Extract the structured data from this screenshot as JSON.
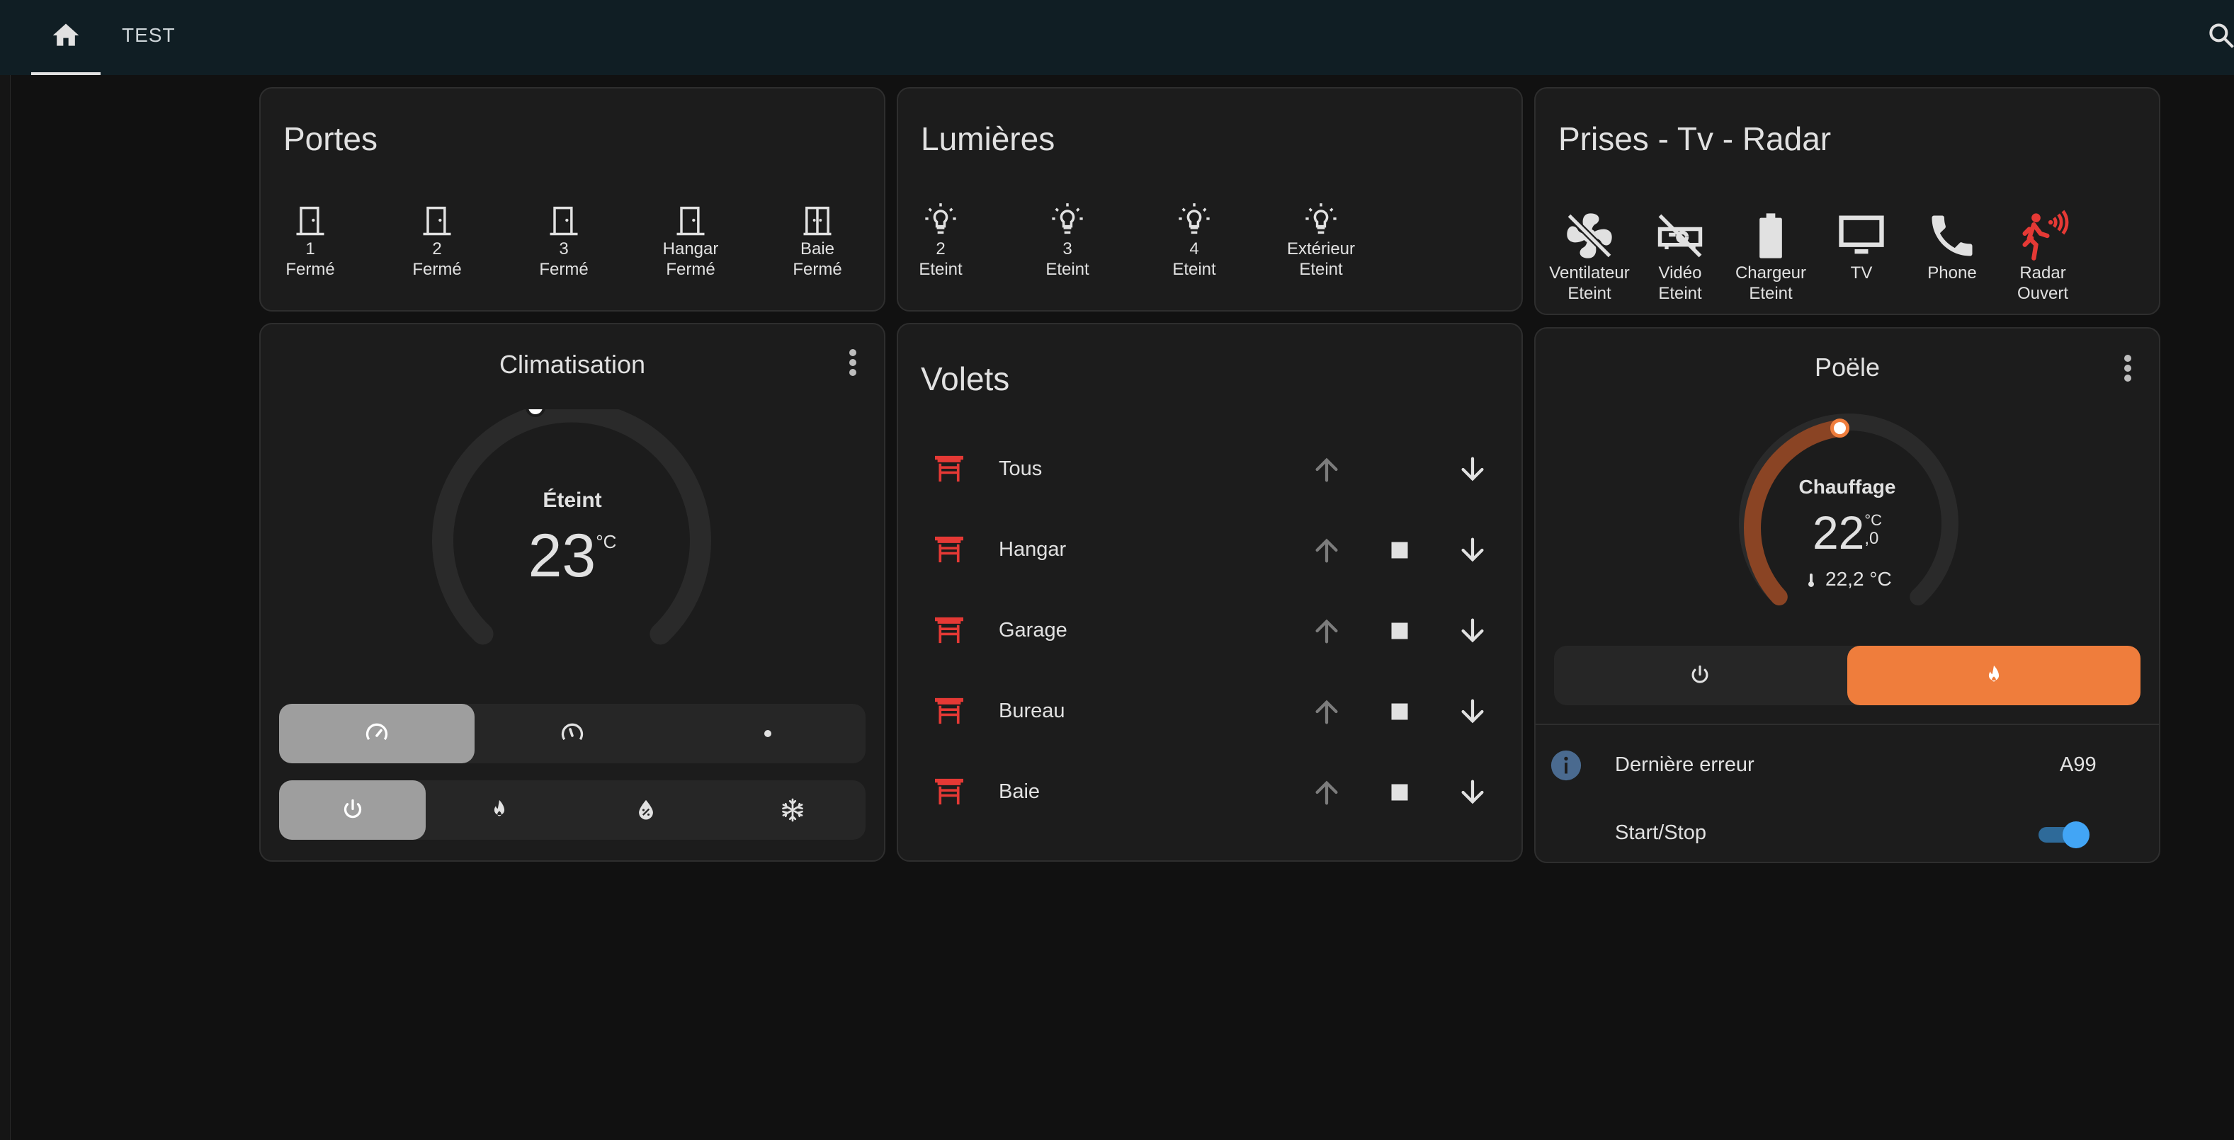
{
  "topbar": {
    "tabs": [
      {
        "label": "TEST"
      }
    ],
    "icons": [
      "home-icon",
      "search-icon"
    ]
  },
  "portes": {
    "title": "Portes",
    "items": [
      {
        "name": "1",
        "state": "Fermé",
        "icon": "door-closed-icon"
      },
      {
        "name": "2",
        "state": "Fermé",
        "icon": "door-closed-icon"
      },
      {
        "name": "3",
        "state": "Fermé",
        "icon": "door-closed-icon"
      },
      {
        "name": "Hangar",
        "state": "Fermé",
        "icon": "door-closed-icon"
      },
      {
        "name": "Baie",
        "state": "Fermé",
        "icon": "double-door-icon"
      }
    ]
  },
  "lumieres": {
    "title": "Lumières",
    "items": [
      {
        "name": "2",
        "state": "Eteint",
        "icon": "lightbulb-icon"
      },
      {
        "name": "3",
        "state": "Eteint",
        "icon": "lightbulb-icon"
      },
      {
        "name": "4",
        "state": "Eteint",
        "icon": "lightbulb-icon"
      },
      {
        "name": "Extérieur",
        "state": "Eteint",
        "icon": "lightbulb-icon"
      }
    ]
  },
  "prises": {
    "title": "Prises - Tv - Radar",
    "items": [
      {
        "name": "Ventilateur",
        "state": "Eteint",
        "icon": "fan-off-icon"
      },
      {
        "name": "Vidéo",
        "state": "Eteint",
        "icon": "projector-off-icon"
      },
      {
        "name": "Chargeur",
        "state": "Eteint",
        "icon": "battery-icon"
      },
      {
        "name": "TV",
        "state": "",
        "icon": "monitor-icon"
      },
      {
        "name": "Phone",
        "state": "",
        "icon": "phone-icon"
      },
      {
        "name": "Radar",
        "state": "Ouvert",
        "icon": "motion-sensor-icon"
      }
    ],
    "colors": {
      "radar": "#e53935"
    }
  },
  "climatisation": {
    "title": "Climatisation",
    "status": "Éteint",
    "target": "23",
    "unit": "°C",
    "level": 0.0,
    "fan_modes": [
      "speedometer-icon",
      "speedometer-medium-icon",
      "dot-icon"
    ],
    "hvac_modes": [
      "power-icon",
      "fire-icon",
      "water-percent-icon",
      "snowflake-icon"
    ]
  },
  "volets": {
    "title": "Volets",
    "rows": [
      {
        "name": "Tous",
        "has_stop": false
      },
      {
        "name": "Hangar",
        "has_stop": true
      },
      {
        "name": "Garage",
        "has_stop": true
      },
      {
        "name": "Bureau",
        "has_stop": true
      },
      {
        "name": "Baie",
        "has_stop": true
      }
    ],
    "colors": {
      "shutter": "#e53935"
    }
  },
  "poele": {
    "title": "Poële",
    "action": "Chauffage",
    "target_int": "22",
    "target_dec": ",0",
    "unit": "°C",
    "current": "22,2 °C",
    "level": 0.0,
    "modes": [
      "power-icon",
      "fire-icon"
    ],
    "colors": {
      "accent": "#ef7d3c",
      "arc": "#8a4424"
    },
    "error_label": "Dernière erreur",
    "error_value": "A99",
    "startstop_label": "Start/Stop",
    "startstop_on": true
  }
}
